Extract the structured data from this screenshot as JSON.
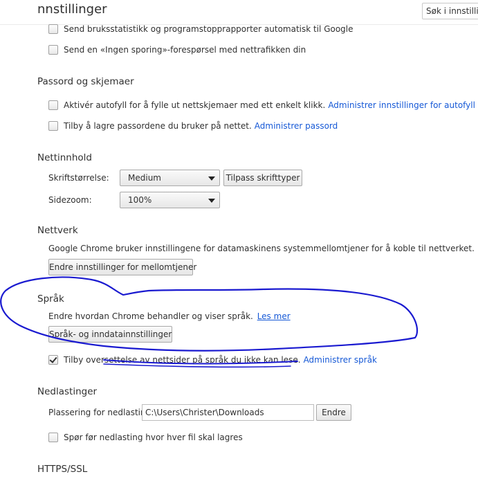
{
  "header": {
    "title": "nnstillinger",
    "search_placeholder": "Søk i innstilling"
  },
  "privacy": {
    "items": [
      {
        "label": "Send bruksstatistikk og programstopprapporter automatisk til Google",
        "checked": false
      },
      {
        "label": "Send en «Ingen sporing»-forespørsel med nettrafikken din",
        "checked": false
      }
    ]
  },
  "passwords": {
    "title": "Passord og skjemaer",
    "autofill_label": "Aktivér autofyll for å fylle ut nettskjemaer med ett enkelt klikk.",
    "autofill_link": "Administrer innstillinger for autofyll",
    "save_label": "Tilby å lagre passordene du bruker på nettet.",
    "save_link": "Administrer passord"
  },
  "web_content": {
    "title": "Nettinnhold",
    "font_size_label": "Skriftstørrelse:",
    "font_size_value": "Medium",
    "customize_fonts_button": "Tilpass skrifttyper",
    "zoom_label": "Sidezoom:",
    "zoom_value": "100%"
  },
  "network": {
    "title": "Nettverk",
    "description": "Google Chrome bruker innstillingene for datamaskinens systemmellomtjener for å koble til nettverket.",
    "proxy_button": "Endre innstillinger for mellomtjener"
  },
  "languages": {
    "title": "Språk",
    "description": "Endre hvordan Chrome behandler og viser språk.",
    "learn_more": "Les mer",
    "settings_button": "Språk- og inndatainnstillinger",
    "translate_label": "Tilby oversettelse av nettsider på språk du ikke kan lese.",
    "translate_link": "Administrer språk",
    "translate_checked": true
  },
  "downloads": {
    "title": "Nedlastinger",
    "location_label": "Plassering for nedlasting:",
    "location_value": "C:\\Users\\Christer\\Downloads",
    "change_button": "Endre",
    "ask_label": "Spør før nedlasting hvor hver fil skal lagres",
    "ask_checked": false
  },
  "https": {
    "title": "HTTPS/SSL"
  },
  "colors": {
    "link": "#1558d6",
    "annotation": "#1a1ad0"
  }
}
